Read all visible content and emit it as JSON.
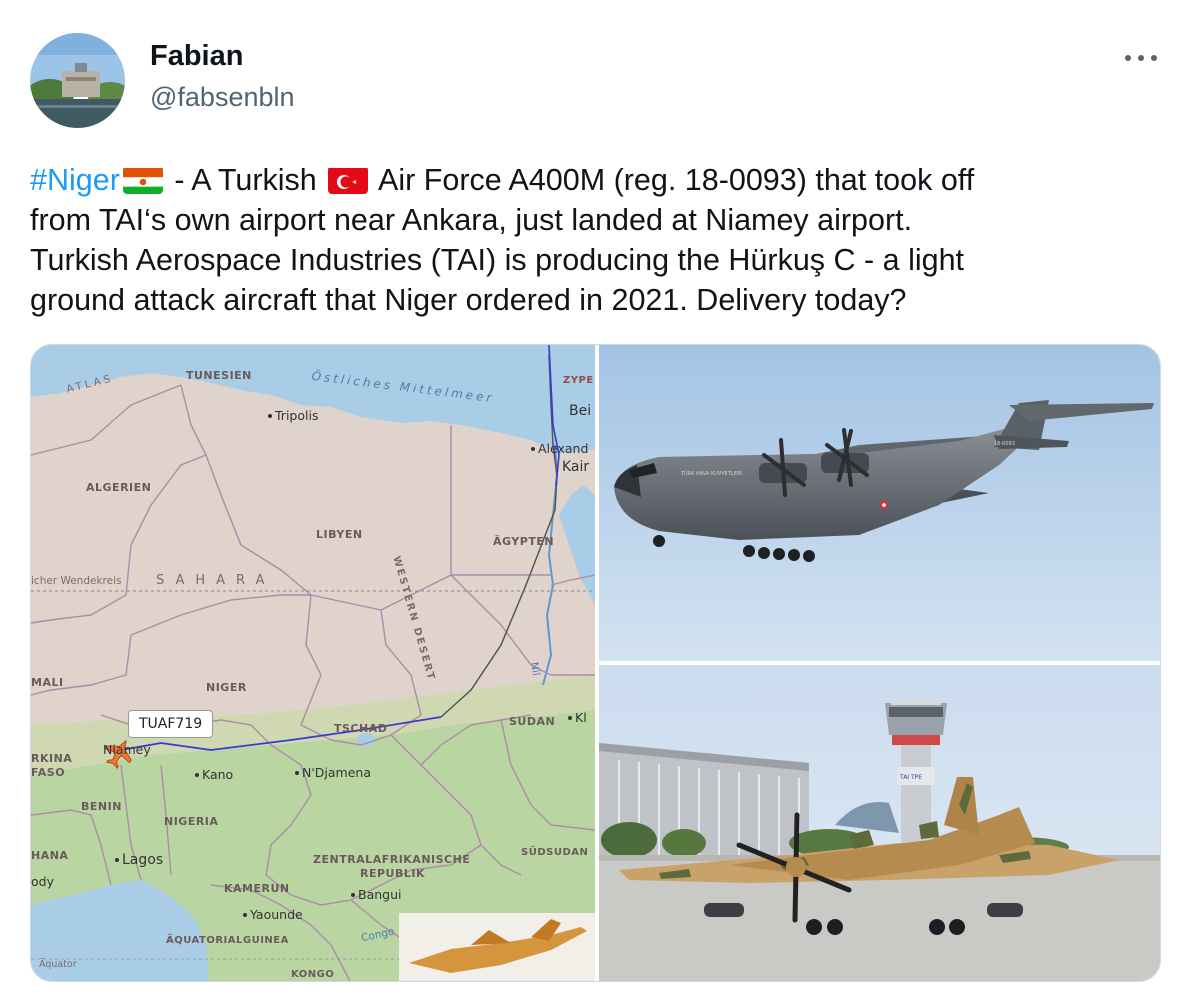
{
  "author": {
    "name": "Fabian",
    "handle": "@fabsenbln"
  },
  "tweet": {
    "hashtag": "#Niger",
    "line1_after_flag": " - A Turkish ",
    "line1_rest": " Air Force A400M (reg. 18-0093) that took off",
    "line2": "from TAI‘s own airport near Ankara, just landed at Niamey airport.",
    "line3": "Turkish Aerospace Industries (TAI) is producing the Hürkuş C - a light",
    "line4": "ground attack aircraft that Niger ordered in 2021. Delivery today?"
  },
  "map": {
    "flight_tag": "TUAF719",
    "labels": {
      "tunesien": "TUNESIEN",
      "atlas": "ATLAS",
      "sea": "Östliches Mittelmeer",
      "tripolis": "Tripolis",
      "zypern": "ZYPE",
      "beirut": "Bei",
      "alexandria": "Alexand",
      "kairo": "Kair",
      "algerien": "ALGERIEN",
      "libyen": "LIBYEN",
      "aegypten": "ÄGYPTEN",
      "western_desert": "WESTERN DESERT",
      "wendekreis": "icher Wendekreis",
      "sahara": "SAHARA",
      "mali": "MALI",
      "niger": "NIGER",
      "sudan": "SUDAN",
      "tschad": "TSCHAD",
      "burkina1": "RKINA",
      "burkina2": "FASO",
      "niamey": "Niamey",
      "kano": "Kano",
      "ndjamena": "N'Djamena",
      "benin": "BENIN",
      "nigeria": "NIGERIA",
      "ghana": "HANA",
      "lagos": "Lagos",
      "cody": "ody",
      "zar1": "ZENTRALAFRIKANISCHE",
      "zar2": "REPUBLIK",
      "suedsudan": "SÜDSUDAN",
      "kamerun": "KAMERUN",
      "bangui": "Bangui",
      "yaounde": "Yaounde",
      "aequatorialguinea": "ÄQUATORIALGUINEA",
      "congo": "Congo",
      "aequator": "Äquator",
      "kongo": "KONGO",
      "nil": "Nil",
      "kl": "Kl"
    }
  },
  "photos": {
    "a400m_markings": "TÜRK HAVA KUVVETLERİ",
    "a400m_reg": "18-0093",
    "tower_text": "TAI TPE"
  },
  "colors": {
    "link": "#1d9bf0",
    "secondary_text": "#536471",
    "route": "#3a3acd"
  }
}
